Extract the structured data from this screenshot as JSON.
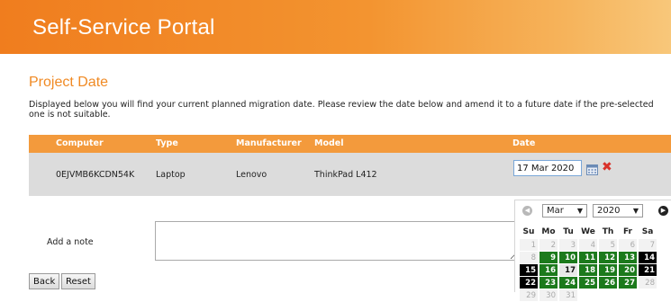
{
  "header": {
    "title": "Self-Service Portal"
  },
  "page": {
    "title": "Project Date",
    "intro": "Displayed below you will find your current planned migration date. Please review the date below and amend it to a future date if the pre-selected one is not suitable."
  },
  "table": {
    "columns": [
      "Computer",
      "Type",
      "Manufacturer",
      "Model",
      "Date"
    ],
    "row": {
      "computer": "0EJVMB6KCDN54K",
      "type": "Laptop",
      "manufacturer": "Lenovo",
      "model": "ThinkPad L412",
      "date": "17 Mar 2020"
    }
  },
  "note": {
    "label": "Add a note",
    "value": ""
  },
  "buttons": {
    "back": "Back",
    "reset": "Reset"
  },
  "calendar": {
    "month": "Mar",
    "year": "2020",
    "prev_icon": "chevron-left-icon",
    "next_icon": "chevron-right-icon",
    "weekdays": [
      "Su",
      "Mo",
      "Tu",
      "We",
      "Th",
      "Fr",
      "Sa"
    ],
    "weeks": [
      [
        {
          "d": "1",
          "s": "disabled"
        },
        {
          "d": "2",
          "s": "disabled"
        },
        {
          "d": "3",
          "s": "disabled"
        },
        {
          "d": "4",
          "s": "disabled"
        },
        {
          "d": "5",
          "s": "disabled"
        },
        {
          "d": "6",
          "s": "disabled"
        },
        {
          "d": "7",
          "s": "disabled"
        }
      ],
      [
        {
          "d": "8",
          "s": "disabled"
        },
        {
          "d": "9",
          "s": "available"
        },
        {
          "d": "10",
          "s": "available"
        },
        {
          "d": "11",
          "s": "available"
        },
        {
          "d": "12",
          "s": "available"
        },
        {
          "d": "13",
          "s": "available"
        },
        {
          "d": "14",
          "s": "blocked"
        }
      ],
      [
        {
          "d": "15",
          "s": "blocked"
        },
        {
          "d": "16",
          "s": "available"
        },
        {
          "d": "17",
          "s": "selected"
        },
        {
          "d": "18",
          "s": "available"
        },
        {
          "d": "19",
          "s": "available"
        },
        {
          "d": "20",
          "s": "available"
        },
        {
          "d": "21",
          "s": "blocked"
        }
      ],
      [
        {
          "d": "22",
          "s": "blocked"
        },
        {
          "d": "23",
          "s": "available"
        },
        {
          "d": "24",
          "s": "available"
        },
        {
          "d": "25",
          "s": "available"
        },
        {
          "d": "26",
          "s": "available"
        },
        {
          "d": "27",
          "s": "available"
        },
        {
          "d": "28",
          "s": "disabled"
        }
      ],
      [
        {
          "d": "29",
          "s": "disabled"
        },
        {
          "d": "30",
          "s": "disabled"
        },
        {
          "d": "31",
          "s": "disabled"
        },
        {
          "d": "",
          "s": "empty"
        },
        {
          "d": "",
          "s": "empty"
        },
        {
          "d": "",
          "s": "empty"
        },
        {
          "d": "",
          "s": "empty"
        }
      ]
    ]
  },
  "colors": {
    "brand": "#f07d1e",
    "table_header": "#f39a3c",
    "available": "#1c7a1c",
    "blocked": "#000000",
    "title": "#f08a24"
  }
}
